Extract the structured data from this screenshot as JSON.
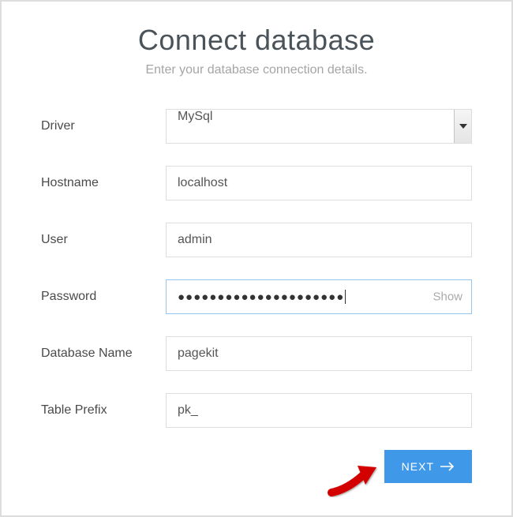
{
  "header": {
    "title": "Connect database",
    "subtitle": "Enter your database connection details."
  },
  "form": {
    "driver": {
      "label": "Driver",
      "value": "MySql"
    },
    "hostname": {
      "label": "Hostname",
      "value": "localhost"
    },
    "user": {
      "label": "User",
      "value": "admin"
    },
    "password": {
      "label": "Password",
      "mask": "●●●●●●●●●●●●●●●●●●●●●",
      "show_label": "Show"
    },
    "database": {
      "label": "Database Name",
      "value": "pagekit"
    },
    "prefix": {
      "label": "Table Prefix",
      "value": "pk_"
    }
  },
  "actions": {
    "next_label": "NEXT"
  }
}
